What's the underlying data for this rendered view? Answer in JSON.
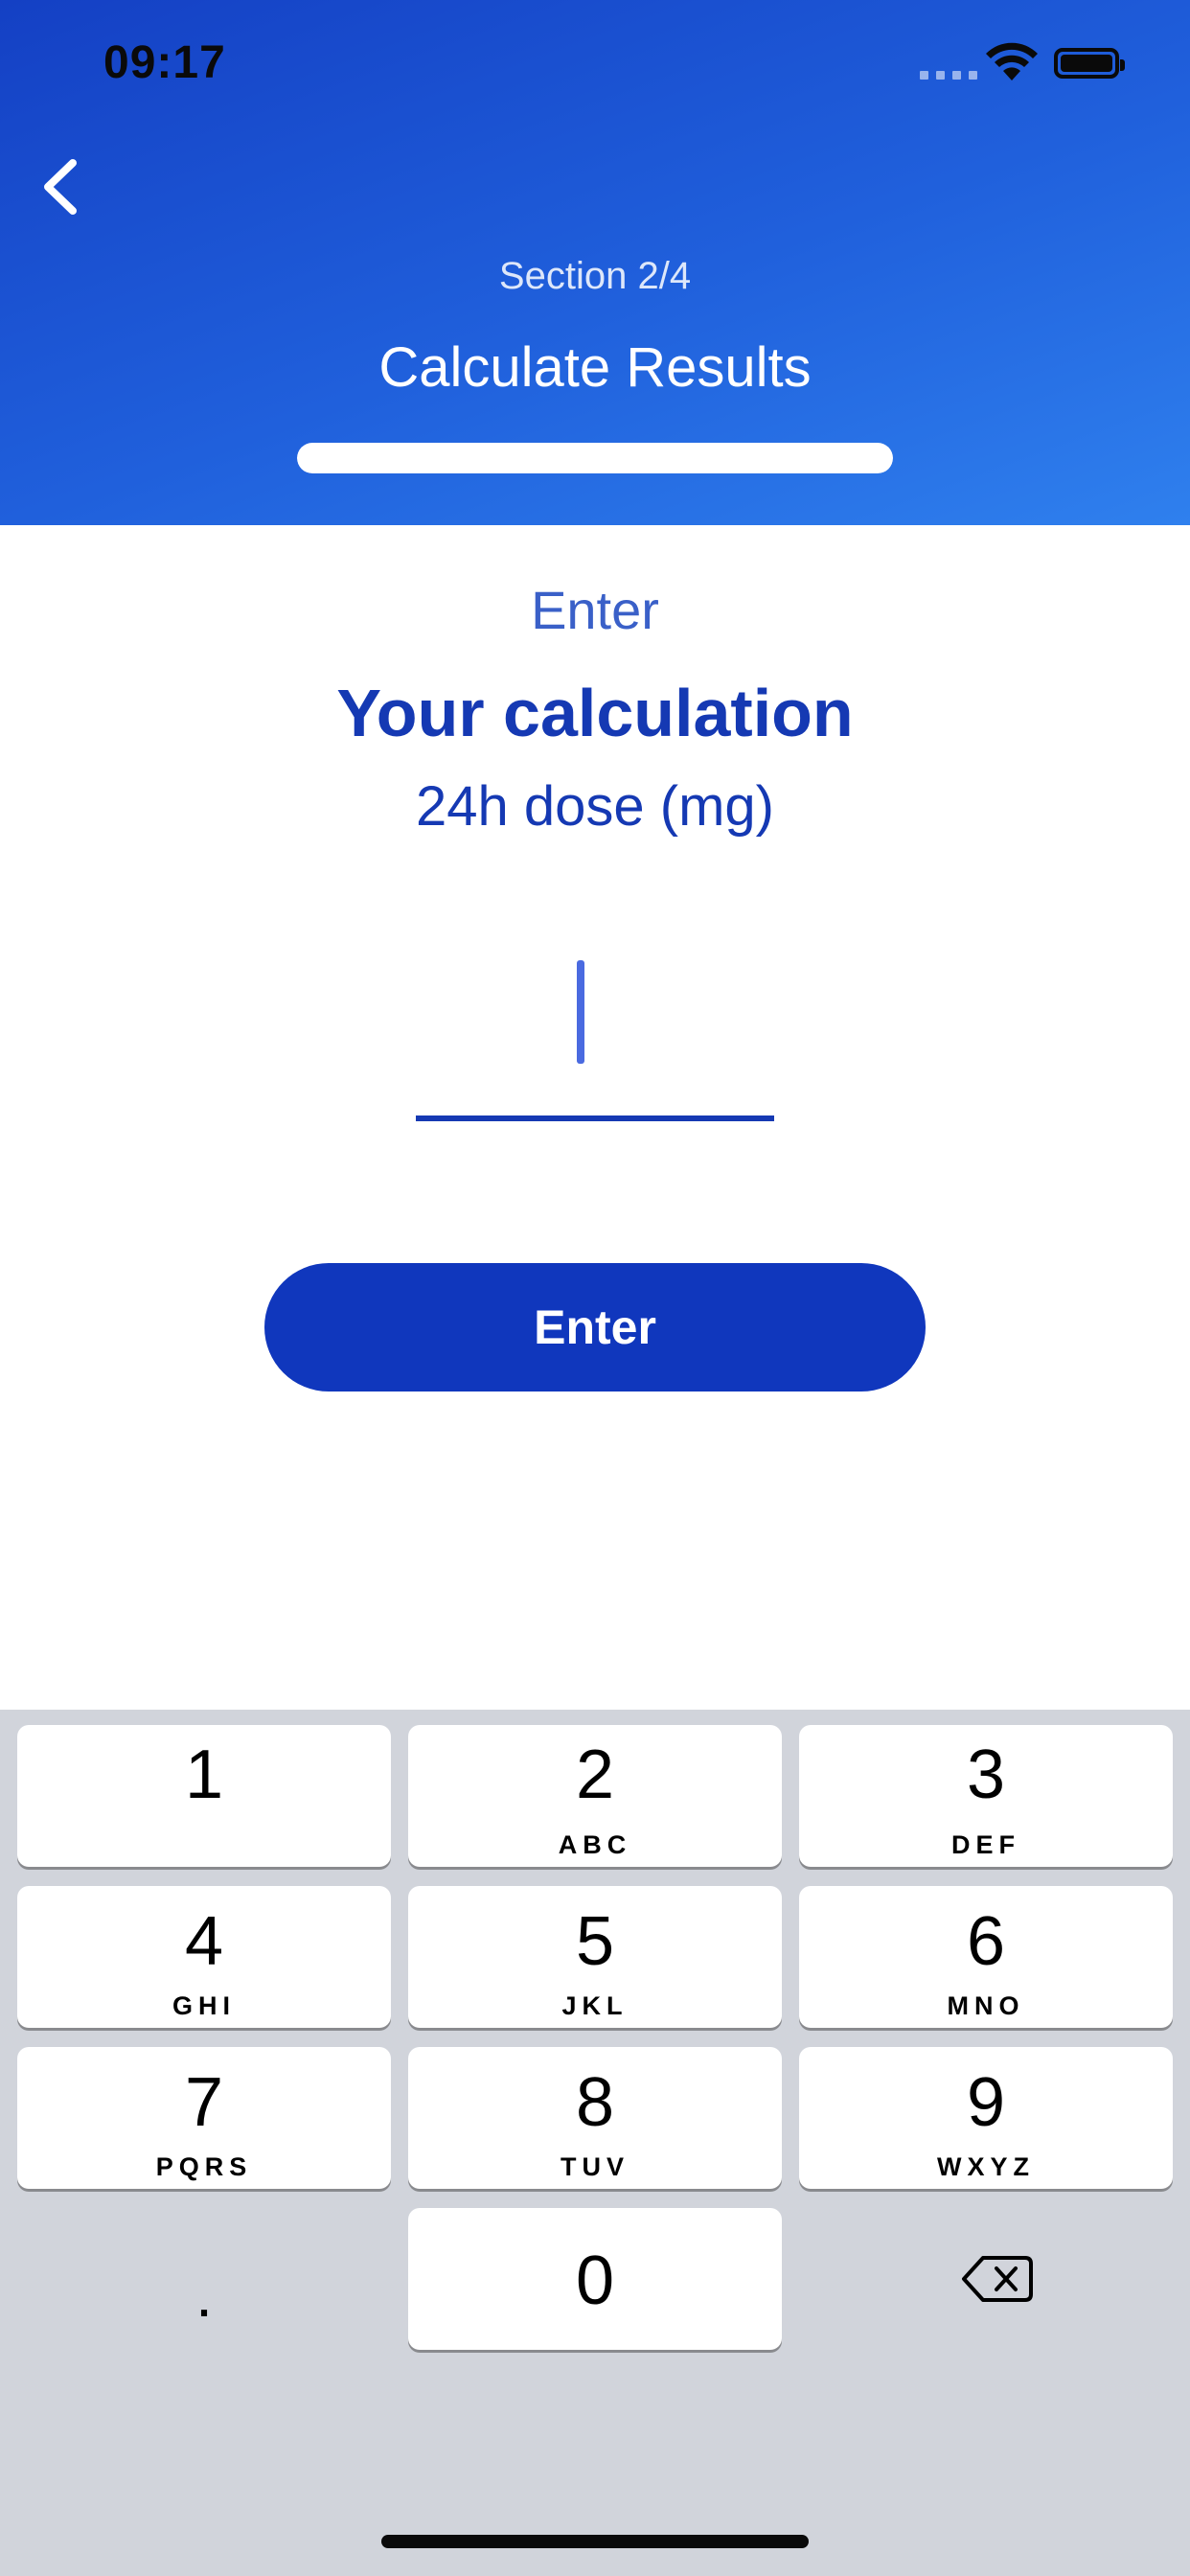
{
  "status_bar": {
    "time": "09:17"
  },
  "header": {
    "section": "Section 2/4",
    "title": "Calculate Results",
    "progress_fraction": 1.0
  },
  "prompt": {
    "label": "Enter",
    "title": "Your calculation",
    "unit": "24h dose (mg)"
  },
  "dose_input": {
    "value": ""
  },
  "enter_button": {
    "label": "Enter"
  },
  "keyboard": {
    "keys": [
      {
        "digit": "1",
        "letters": ""
      },
      {
        "digit": "2",
        "letters": "ABC"
      },
      {
        "digit": "3",
        "letters": "DEF"
      },
      {
        "digit": "4",
        "letters": "GHI"
      },
      {
        "digit": "5",
        "letters": "JKL"
      },
      {
        "digit": "6",
        "letters": "MNO"
      },
      {
        "digit": "7",
        "letters": "PQRS"
      },
      {
        "digit": "8",
        "letters": "TUV"
      },
      {
        "digit": "9",
        "letters": "WXYZ"
      },
      {
        "digit": "0",
        "letters": ""
      }
    ],
    "decimal": ".",
    "delete_icon": "backspace-icon"
  },
  "colors": {
    "header_gradient_start": "#1440c4",
    "header_gradient_end": "#2f80ee",
    "accent": "#1539b3",
    "button": "#1037bd",
    "keyboard_bg": "#d1d4db"
  }
}
